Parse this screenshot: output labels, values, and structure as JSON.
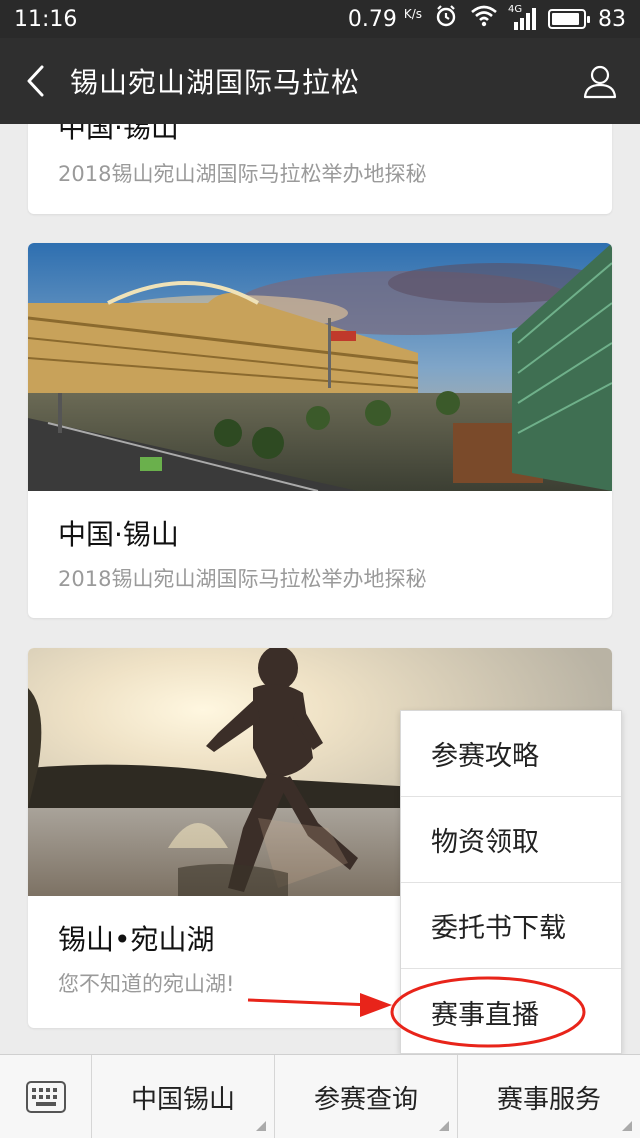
{
  "status_bar": {
    "time": "11:16",
    "speed": "0.79",
    "speed_unit": "K/s",
    "network": "4G",
    "battery": "83"
  },
  "nav": {
    "title": "锡山宛山湖国际马拉松"
  },
  "cards": [
    {
      "title": "中国·锡山",
      "subtitle": "2018锡山宛山湖国际马拉松举办地探秘"
    },
    {
      "title": "中国·锡山",
      "subtitle": "2018锡山宛山湖国际马拉松举办地探秘"
    },
    {
      "title": "锡山•宛山湖",
      "subtitle": "您不知道的宛山湖!"
    }
  ],
  "popup_menu": {
    "items": [
      "参赛攻略",
      "物资领取",
      "委托书下载",
      "赛事直播"
    ]
  },
  "bottom_tabs": [
    "中国锡山",
    "参赛查询",
    "赛事服务"
  ],
  "colors": {
    "nav_bg": "#2f2f2f",
    "annotation_red": "#e8241a"
  }
}
